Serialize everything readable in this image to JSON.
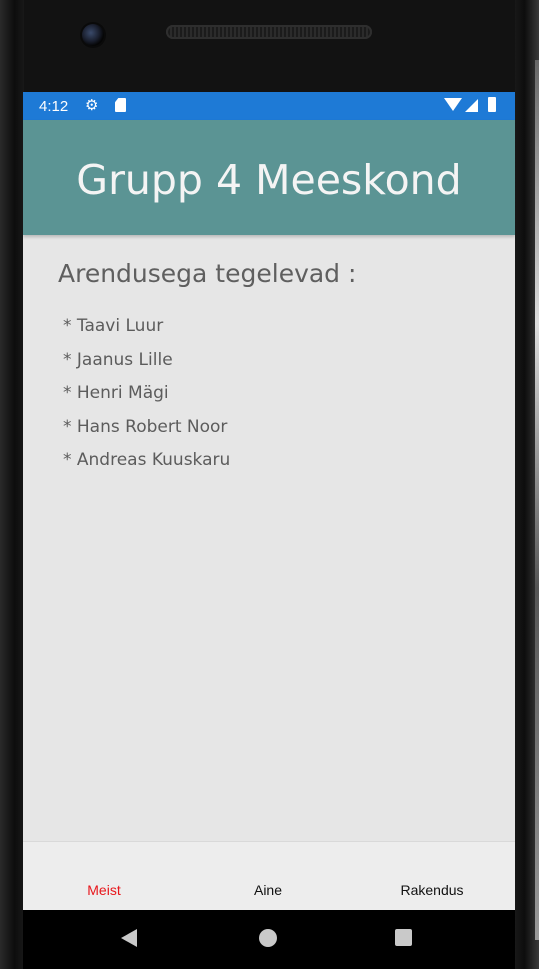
{
  "status_bar": {
    "time": "4:12",
    "color": "#1e7ad6",
    "icons": [
      "gear-icon",
      "sd-card-icon",
      "wifi-icon",
      "cell-signal-icon",
      "battery-icon"
    ]
  },
  "app_bar": {
    "title": "Grupp 4 Meeskond",
    "color": "#5b9494"
  },
  "content": {
    "heading": "Arendusega tegelevad :",
    "members": [
      "* Taavi Luur",
      "* Jaanus Lille",
      "* Henri Mägi",
      "* Hans Robert Noor",
      "* Andreas Kuuskaru"
    ]
  },
  "bottom_nav": {
    "tabs": [
      {
        "label": "Meist",
        "active": true
      },
      {
        "label": "Aine",
        "active": false
      },
      {
        "label": "Rakendus",
        "active": false
      }
    ],
    "active_color": "#e8161b"
  },
  "system_nav": {
    "buttons": [
      "back-icon",
      "home-icon",
      "recents-icon"
    ]
  }
}
